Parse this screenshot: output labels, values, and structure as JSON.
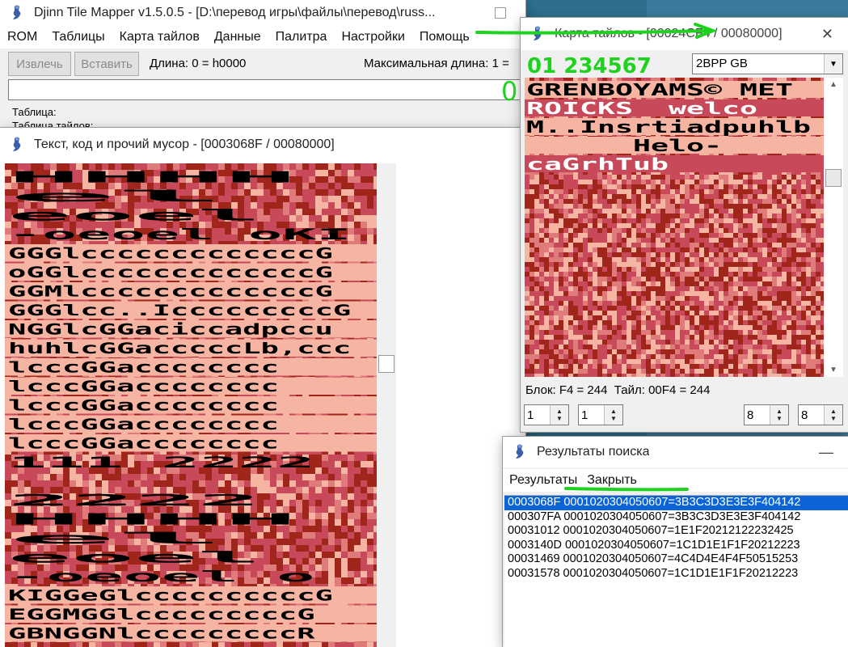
{
  "main_window": {
    "title": "Djinn Tile Mapper v1.5.0.5 - [D:\\перевод игры\\файлы\\перевод\\russ...",
    "menu": [
      "ROM",
      "Таблицы",
      "Карта тайлов",
      "Данные",
      "Палитра",
      "Настройки",
      "Помощь"
    ],
    "toolbar": {
      "extract_label": "Извлечь",
      "insert_label": "Вставить",
      "length_label": "Длина: 0 = h0000",
      "max_length_label": "Максимальная длина: 1 ="
    },
    "info": {
      "table_label": "Таблица:",
      "tile_table_label": "Таблица тайлов:"
    }
  },
  "text_window": {
    "title": "Текст, код и прочий мусор - [0003068F / 00080000]"
  },
  "tilemap_window": {
    "title": "Карта тайлов - [00024CF4 / 00080000]",
    "format_value": "2BPP GB",
    "status": "Блок: F4 = 244  Тайл: 00F4 = 244",
    "spinners": [
      "1",
      "1",
      "8",
      "8"
    ],
    "tile_text_rows": [
      "GRENBOYAMS© MET",
      "ROICKS  welco",
      "M..Insrtiadpuhlb",
      "      Helo-",
      "caGrhTub"
    ]
  },
  "annotation": {
    "digits_text": "01 234567",
    "zero_text": "0"
  },
  "search_window": {
    "title": "Результаты поиска",
    "menu": [
      "Результаты",
      "Закрыть"
    ],
    "results": [
      "0003068F 0001020304050607=3B3C3D3E3E3F404142",
      "000307FA 0001020304050607=3B3C3D3E3E3F404142",
      "00031012 0001020304050607=1E1F20212122232425",
      "0003140D 0001020304050607=1C1D1E1F1F20212223",
      "00031469 0001020304050607=4C4D4E4F4F50515253",
      "00031578 0001020304050607=1C1D1E1F1F20212223"
    ],
    "selected_index": 0
  },
  "text_canvas_rows": [
    "            HHHH",
    "          el",
    "          eoel",
    "        -oeoel  oKI",
    "GGGlcccccccccccccG",
    "oGGlcccccccccccccG",
    "GGMlcccccccccccccG",
    "GGGlcc..IcccccccccG",
    "NGGlcGGaciccadpccu",
    "huhlcGGacccccLb,ccc",
    "lcccGGacccccccc",
    "lcccGGacccccccc",
    "lcccGGacccccccc",
    "lcccGGacccccccc",
    "lcccGGacccccccc",
    "111          2222",
    "",
    "          2222",
    "            HHHH",
    "          el",
    "          eoel",
    "        -oeoel  o",
    "KIGGeGlccccccccccG",
    "EGGMGGlcccccccccG",
    "GBNGGNlcccccccccR"
  ],
  "colors": {
    "tile_dark": "#a0251a",
    "tile_mid": "#c8495a",
    "tile_light": "#f6b4a2",
    "selection": "#0a64d8",
    "annotation_green": "#1fd21f"
  }
}
